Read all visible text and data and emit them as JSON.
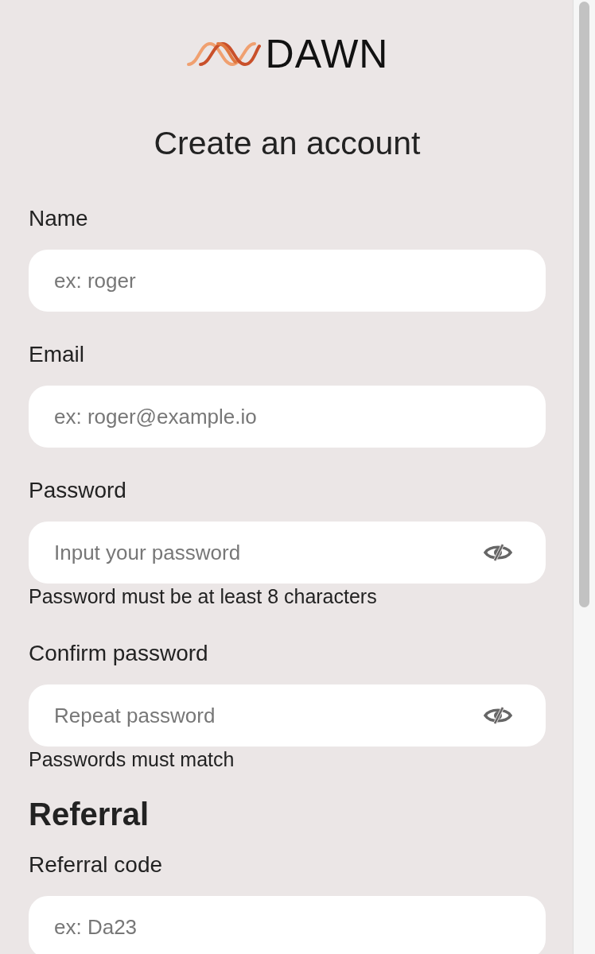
{
  "logo": {
    "text": "DAWN"
  },
  "title": "Create an account",
  "items": [
    {
      "kind": "field",
      "label": "Name",
      "placeholder": "ex: roger",
      "masked": false
    },
    {
      "kind": "field",
      "label": "Email",
      "placeholder": "ex: roger@example.io",
      "masked": false
    },
    {
      "kind": "field",
      "label": "Password",
      "placeholder": "Input your password",
      "masked": true,
      "hint": "Password must be at least 8 characters"
    },
    {
      "kind": "field",
      "label": "Confirm password",
      "placeholder": "Repeat password",
      "masked": true,
      "hint": "Passwords must match"
    },
    {
      "kind": "heading",
      "text": "Referral"
    },
    {
      "kind": "field",
      "label": "Referral code",
      "placeholder": "ex: Da23",
      "masked": false
    }
  ]
}
